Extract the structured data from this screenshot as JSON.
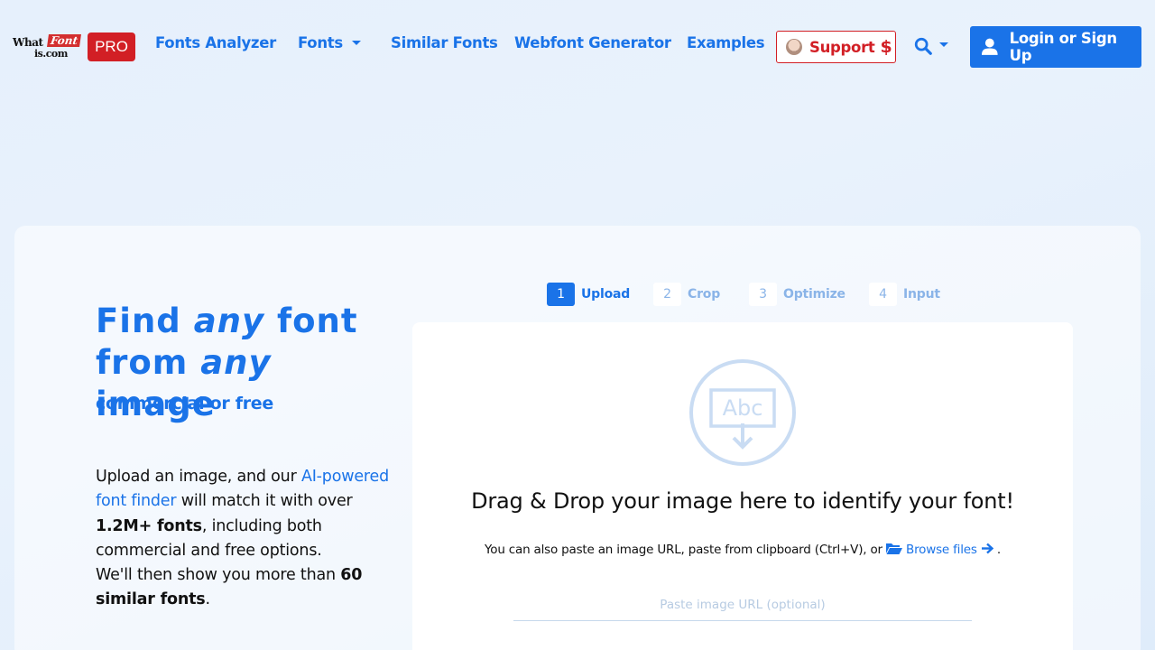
{
  "logo": {
    "what": "What",
    "font": "Font",
    "com": "is.com"
  },
  "nav": {
    "pro": "PRO",
    "fonts_analyzer": "Fonts Analyzer",
    "fonts": "Fonts",
    "similar_fonts": "Similar Fonts",
    "webfont_generator": "Webfont Generator",
    "examples": "Examples",
    "support": "Support",
    "support_symbol": "$",
    "login": "Login or Sign Up"
  },
  "hero": {
    "line1_a": "Find",
    "line1_em": "any",
    "line1_b": "font",
    "line2_a": "from",
    "line2_em": "any",
    "line2_b": "image",
    "subtitle": "commercial or free",
    "desc_1": "Upload an image, and our",
    "desc_link": "AI-powered font finder",
    "desc_2": "will match it with over",
    "desc_bold1": "1.2M+ fonts",
    "desc_3": ", including both commercial and free options.",
    "desc_4": "We'll then show you more than",
    "desc_bold2": "60 similar fonts",
    "desc_5": "."
  },
  "steps": [
    {
      "num": "1",
      "label": "Upload",
      "active": true
    },
    {
      "num": "2",
      "label": "Crop",
      "active": false
    },
    {
      "num": "3",
      "label": "Optimize",
      "active": false
    },
    {
      "num": "4",
      "label": "Input",
      "active": false
    }
  ],
  "upload": {
    "icon_text": "Abc",
    "title": "Drag & Drop your image here to identify your font!",
    "hint": "You can also paste an image URL, paste from clipboard (Ctrl+V), or",
    "browse": "Browse files",
    "hint_end": ".",
    "url_placeholder": "Paste image URL (optional)"
  },
  "colors": {
    "brand_blue": "#1a73e8",
    "brand_red": "#d21f25",
    "muted_blue": "#8ab4e8"
  }
}
